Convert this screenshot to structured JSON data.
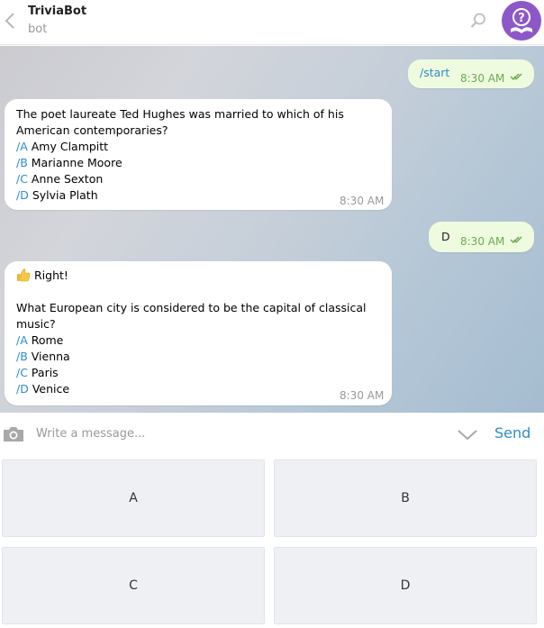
{
  "header": {
    "title": "TriviaBot",
    "subtitle": "bot",
    "avatar_color": "#8e57c7",
    "icons": [
      "back-arrow-icon",
      "search-icon",
      "avatar-question-book-icon"
    ]
  },
  "messages": [
    {
      "direction": "out",
      "text": "/start",
      "time": "8:30 AM"
    },
    {
      "direction": "in",
      "question": "The poet laureate Ted Hughes was married to which of his American contemporaries?",
      "options": [
        {
          "cmd": "/A",
          "text": " Amy Clampitt"
        },
        {
          "cmd": "/B",
          "text": " Marianne Moore"
        },
        {
          "cmd": "/C",
          "text": " Anne Sexton"
        },
        {
          "cmd": "/D",
          "text": " Sylvia Plath"
        }
      ],
      "time": "8:30 AM"
    },
    {
      "direction": "out",
      "text": "D",
      "time": "8:30 AM"
    },
    {
      "direction": "in",
      "feedback": "Right!",
      "question": "What European city is considered to be the capital of classical music?",
      "options": [
        {
          "cmd": "/A",
          "text": " Rome"
        },
        {
          "cmd": "/B",
          "text": " Vienna"
        },
        {
          "cmd": "/C",
          "text": " Paris"
        },
        {
          "cmd": "/D",
          "text": " Venice"
        }
      ],
      "time": "8:30 AM"
    }
  ],
  "composer": {
    "placeholder": "Write a message...",
    "send_label": "Send"
  },
  "keyboard": {
    "buttons": [
      "A",
      "B",
      "C",
      "D"
    ]
  },
  "colors": {
    "link": "#2d8cc9",
    "outgoing_bubble": "#eefbdf",
    "incoming_bubble": "#ffffff",
    "read_checks": "#6cab50"
  }
}
